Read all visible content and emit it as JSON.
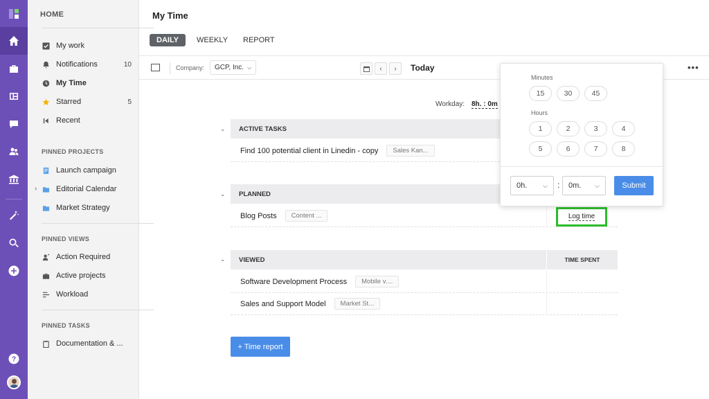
{
  "page": {
    "title": "My Time"
  },
  "tabs": [
    {
      "label": "DAILY",
      "active": true
    },
    {
      "label": "WEEKLY",
      "active": false
    },
    {
      "label": "REPORT",
      "active": false
    }
  ],
  "sidebar": {
    "heading": "HOME",
    "main_items": [
      {
        "label": "My work",
        "icon": "check-square-icon"
      },
      {
        "label": "Notifications",
        "icon": "bell-icon",
        "count": "10"
      },
      {
        "label": "My Time",
        "icon": "clock-icon",
        "active": true
      },
      {
        "label": "Starred",
        "icon": "star-icon",
        "count": "5"
      },
      {
        "label": "Recent",
        "icon": "recent-icon"
      }
    ],
    "pinned_projects_title": "PINNED PROJECTS",
    "pinned_projects": [
      {
        "label": "Launch campaign",
        "icon": "document-icon"
      },
      {
        "label": "Editorial Calendar",
        "icon": "folder-icon"
      },
      {
        "label": "Market Strategy",
        "icon": "folder-icon"
      }
    ],
    "pinned_views_title": "PINNED VIEWS",
    "pinned_views": [
      {
        "label": "Action Required",
        "icon": "user-action-icon"
      },
      {
        "label": "Active projects",
        "icon": "briefcase-icon"
      },
      {
        "label": "Workload",
        "icon": "workload-icon"
      }
    ],
    "pinned_tasks_title": "PINNED TASKS",
    "pinned_tasks": [
      {
        "label": "Documentation & ...",
        "icon": "clipboard-icon"
      }
    ]
  },
  "toolbar": {
    "company_label": "Company:",
    "company_value": "GCP, Inc.",
    "date_label": "Today"
  },
  "workday": {
    "label": "Workday:",
    "value": "8h. : 0m"
  },
  "sections": {
    "active": {
      "title": "ACTIVE TASKS",
      "rows": [
        {
          "name": "Find 100 potential client in Linedin - copy",
          "tag": "Sales Kan..."
        }
      ]
    },
    "planned": {
      "title": "PLANNED",
      "rows": [
        {
          "name": "Blog Posts",
          "tag": "Content ..."
        }
      ],
      "log_time_label": "Log time"
    },
    "viewed": {
      "title": "VIEWED",
      "time_spent_label": "TIME SPENT",
      "rows": [
        {
          "name": "Software Development Process",
          "tag": "Mobile v...."
        },
        {
          "name": "Sales and Support Model",
          "tag": "Market St..."
        }
      ]
    }
  },
  "time_report_button": "+ Time report",
  "popover": {
    "minutes_label": "Minutes",
    "minutes": [
      "15",
      "30",
      "45"
    ],
    "hours_label": "Hours",
    "hours": [
      "1",
      "2",
      "3",
      "4",
      "5",
      "6",
      "7",
      "8"
    ],
    "hours_select": "0h.",
    "minutes_select": "0m.",
    "separator": ":",
    "submit_label": "Submit"
  },
  "colors": {
    "rail": "#6d4fb8",
    "accent": "#4a8de8",
    "highlight": "#2bbd2b"
  }
}
